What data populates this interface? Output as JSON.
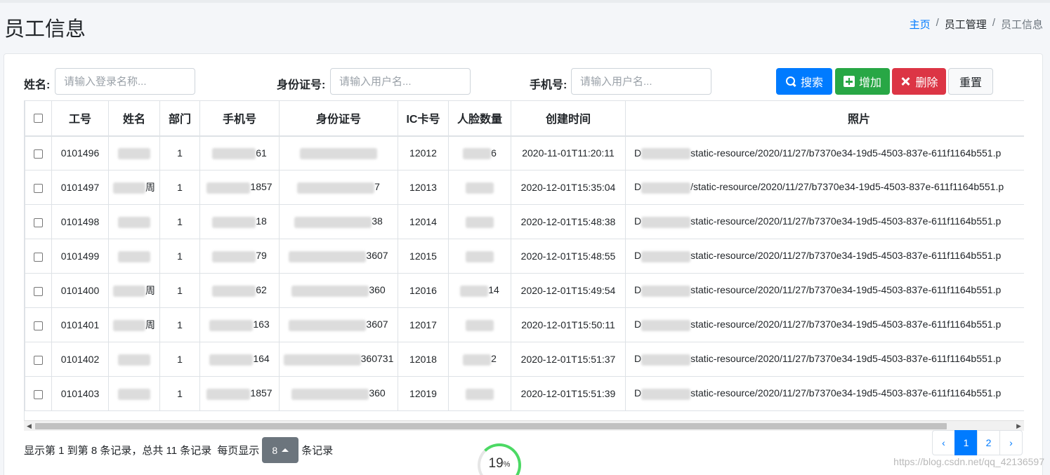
{
  "page": {
    "title": "员工信息"
  },
  "breadcrumb": {
    "home": "主页",
    "section": "员工管理",
    "current": "员工信息"
  },
  "filters": {
    "name_label": "姓名:",
    "name_placeholder": "请输入登录名称...",
    "id_label": "身份证号:",
    "id_placeholder": "请输入用户名...",
    "phone_label": "手机号:",
    "phone_placeholder": "请输入用户名..."
  },
  "buttons": {
    "search": "搜索",
    "add": "增加",
    "delete": "删除",
    "reset": "重置"
  },
  "table": {
    "headers": [
      "工号",
      "姓名",
      "部门",
      "手机号",
      "身份证号",
      "IC卡号",
      "人脸数量",
      "创建时间",
      "照片"
    ],
    "rows": [
      {
        "id": "0101496",
        "name": "",
        "dept": "1",
        "phone": "61",
        "idcard": "",
        "ic": "12012",
        "faces": "6",
        "created": "2020-11-01T11:20:11",
        "photo": "static-resource/2020/11/27/b7370e34-19d5-4503-837e-611f1164b551.p"
      },
      {
        "id": "0101497",
        "name": "周",
        "dept": "1",
        "phone": "1857",
        "idcard": "7",
        "ic": "12013",
        "faces": "",
        "created": "2020-12-01T15:35:04",
        "photo": "/static-resource/2020/11/27/b7370e34-19d5-4503-837e-611f1164b551.p"
      },
      {
        "id": "0101498",
        "name": "",
        "dept": "1",
        "phone": "18",
        "idcard": "38",
        "ic": "12014",
        "faces": "",
        "created": "2020-12-01T15:48:38",
        "photo": "static-resource/2020/11/27/b7370e34-19d5-4503-837e-611f1164b551.p"
      },
      {
        "id": "0101499",
        "name": "",
        "dept": "1",
        "phone": "79",
        "idcard": "3607",
        "ic": "12015",
        "faces": "",
        "created": "2020-12-01T15:48:55",
        "photo": "static-resource/2020/11/27/b7370e34-19d5-4503-837e-611f1164b551.p"
      },
      {
        "id": "0101400",
        "name": "周",
        "dept": "1",
        "phone": "62",
        "idcard": "360",
        "ic": "12016",
        "faces": "14",
        "created": "2020-12-01T15:49:54",
        "photo": "static-resource/2020/11/27/b7370e34-19d5-4503-837e-611f1164b551.p"
      },
      {
        "id": "0101401",
        "name": "周",
        "dept": "1",
        "phone": "163",
        "idcard": "3607",
        "ic": "12017",
        "faces": "",
        "created": "2020-12-01T15:50:11",
        "photo": "static-resource/2020/11/27/b7370e34-19d5-4503-837e-611f1164b551.p"
      },
      {
        "id": "0101402",
        "name": "",
        "dept": "1",
        "phone": "164",
        "idcard": "360731",
        "ic": "12018",
        "faces": "2",
        "created": "2020-12-01T15:51:37",
        "photo": "static-resource/2020/11/27/b7370e34-19d5-4503-837e-611f1164b551.p"
      },
      {
        "id": "0101403",
        "name": "",
        "dept": "1",
        "phone": "1857",
        "idcard": "360",
        "ic": "12019",
        "faces": "",
        "created": "2020-12-01T15:51:39",
        "photo": "static-resource/2020/11/27/b7370e34-19d5-4503-837e-611f1164b551.p"
      }
    ]
  },
  "footer": {
    "summary": "显示第 1 到第 8 条记录，总共 11 条记录",
    "per_page_prefix": "每页显示",
    "page_size": "8",
    "per_page_suffix": "条记录"
  },
  "pagination": {
    "prev": "‹",
    "pages": [
      "1",
      "2"
    ],
    "next": "›",
    "current": "1"
  },
  "loader": {
    "percent": "19",
    "unit": "%"
  },
  "watermark": "https://blog.csdn.net/qq_42136597",
  "colors": {
    "primary": "#007bff",
    "success": "#28a745",
    "danger": "#dc3545",
    "secondary": "#6c757d"
  }
}
